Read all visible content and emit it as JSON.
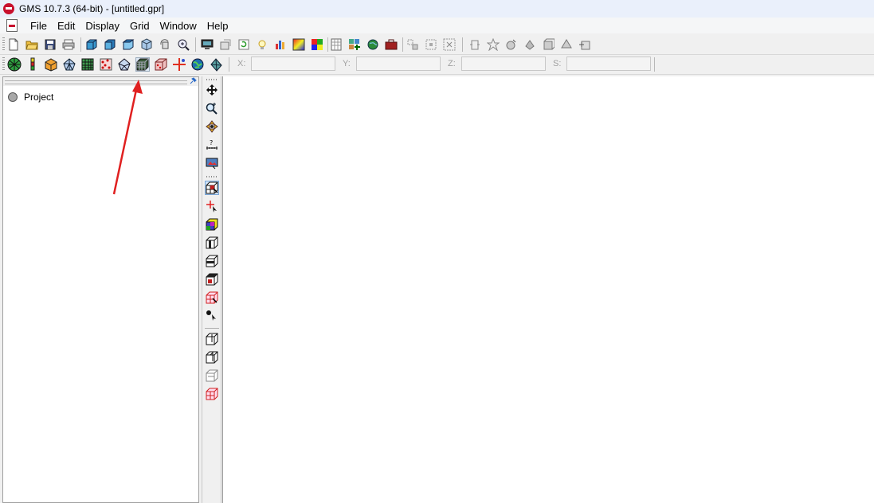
{
  "window": {
    "title": "GMS 10.7.3 (64-bit) - [untitled.gpr]"
  },
  "menu": [
    "File",
    "Edit",
    "Display",
    "Grid",
    "Window",
    "Help"
  ],
  "coords": {
    "x_label": "X:",
    "y_label": "Y:",
    "z_label": "Z:",
    "s_label": "S:",
    "x_value": "",
    "y_value": "",
    "z_value": "",
    "s_value": ""
  },
  "tree": {
    "root": "Project"
  },
  "annotation": {
    "color": "#e02020",
    "note_target": "3d-grid-module-button"
  }
}
